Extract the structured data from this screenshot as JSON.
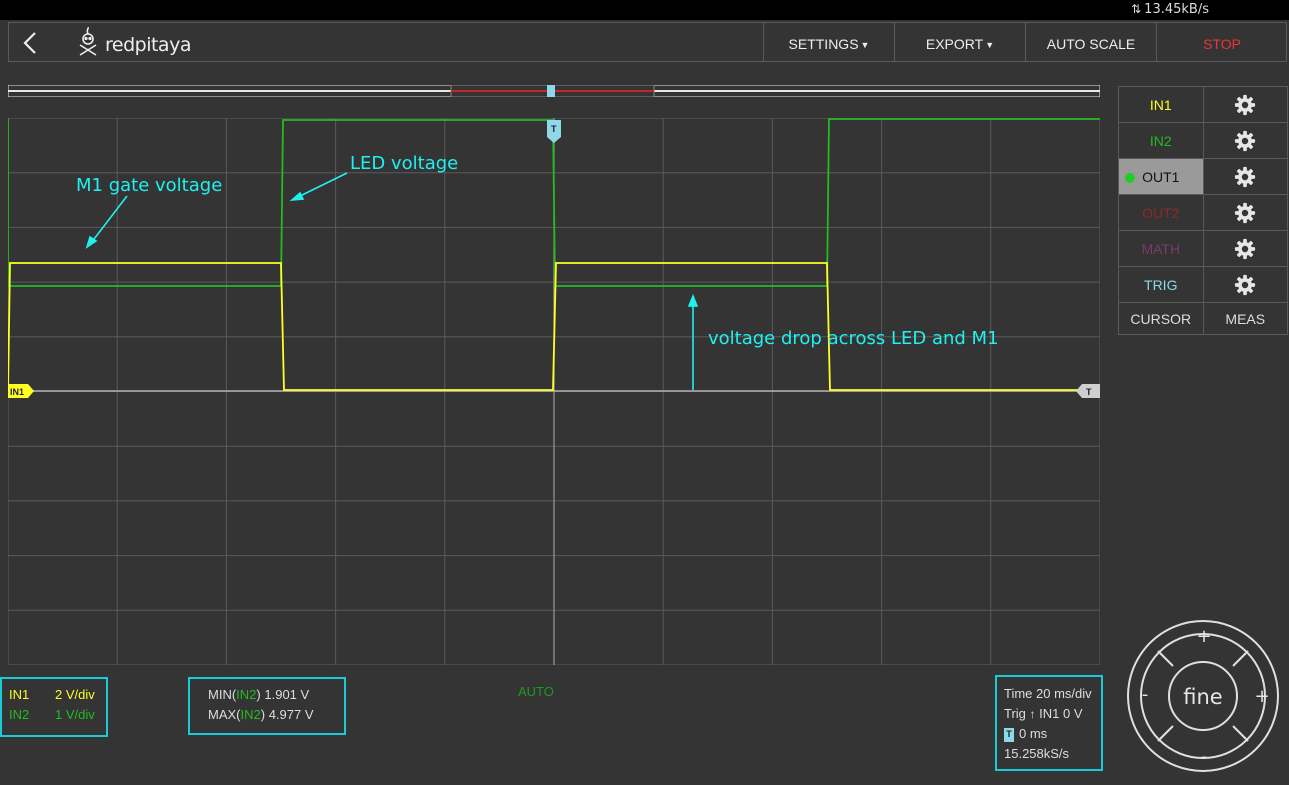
{
  "status_bar": {
    "data_rate": "13.45kB/s"
  },
  "app": {
    "logo_text": "redpitaya"
  },
  "menu": {
    "settings": "SETTINGS",
    "export": "EXPORT",
    "auto_scale": "AUTO SCALE",
    "stop": "STOP"
  },
  "channels_panel": {
    "in1": "IN1",
    "in2": "IN2",
    "out1": "OUT1",
    "out2": "OUT2",
    "math": "MATH",
    "trig": "TRIG",
    "cursor": "CURSOR",
    "meas": "MEAS"
  },
  "plot": {
    "in1_marker": "IN1",
    "trigger_marker": "T",
    "annotations": {
      "gate": "M1 gate voltage",
      "led": "LED voltage",
      "drop": "voltage  drop across LED and M1"
    }
  },
  "scale_info": {
    "in1_label": "IN1",
    "in1_scale": "2 V/div",
    "in2_label": "IN2",
    "in2_scale": "1 V/div"
  },
  "measurements": {
    "min_prefix": "MIN(",
    "min_ch": "IN2",
    "min_suffix": ")",
    "min_value": "1.901 V",
    "max_prefix": "MAX(",
    "max_ch": "IN2",
    "max_suffix": ")",
    "max_value": "4.977 V"
  },
  "acquisition": {
    "mode": "AUTO"
  },
  "timebase": {
    "time": "Time 20 ms/div",
    "trig_prefix": "Trig",
    "trig_rest": "IN1 0 V",
    "trig_badge": "T",
    "offset": "0 ms",
    "sample_rate": "15.258kS/s"
  },
  "jog": {
    "label": "fine",
    "plus": "+",
    "minus": "-"
  },
  "colors": {
    "in1": "#ffff22",
    "in2": "#22bb22",
    "out2": "#8b2a2a",
    "math": "#7a3a6a",
    "trig": "#8fd8ea",
    "stop": "#ee3333",
    "annotation": "#1ff0f0",
    "box_border": "#1cc9d6"
  }
}
